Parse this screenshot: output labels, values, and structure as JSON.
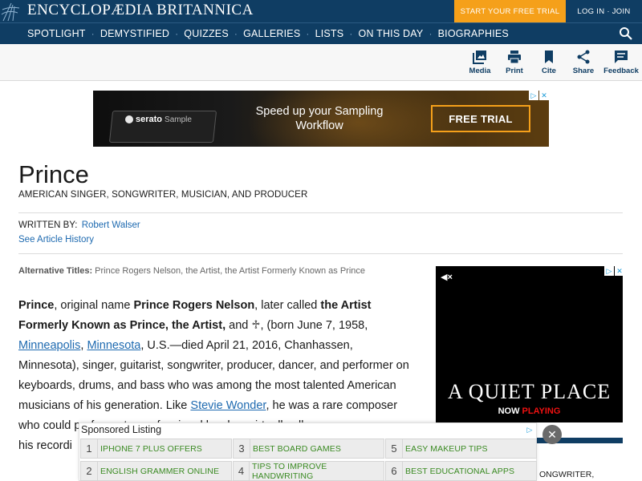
{
  "header": {
    "logo_text": "ENCYCLOPÆDIA BRITANNICA",
    "trial_button": "START YOUR FREE TRIAL",
    "login": "LOG IN · JOIN"
  },
  "nav": {
    "items": [
      "SPOTLIGHT",
      "DEMYSTIFIED",
      "QUIZZES",
      "GALLERIES",
      "LISTS",
      "ON THIS DAY",
      "BIOGRAPHIES"
    ],
    "separator": "·"
  },
  "toolbar": {
    "media": "Media",
    "print": "Print",
    "cite": "Cite",
    "share": "Share",
    "feedback": "Feedback"
  },
  "banner_ad": {
    "brand": "serato",
    "brand_sub": "Sample",
    "headline_line1": "Speed up your Sampling",
    "headline_line2": "Workflow",
    "cta": "FREE TRIAL"
  },
  "article": {
    "title": "Prince",
    "subtitle": "AMERICAN SINGER, SONGWRITER, MUSICIAN, AND PRODUCER",
    "written_by_label": "WRITTEN BY:",
    "author": "Robert Walser",
    "history_link": "See Article History",
    "alt_titles_label": "Alternative Titles:",
    "alt_titles": "Prince Rogers Nelson, the Artist, the Artist Formerly Known as Prince",
    "p1_name": "Prince",
    "p1_t1": ", original name ",
    "p1_full": "Prince Rogers Nelson",
    "p1_t2": ", later called ",
    "p1_artist_formerly": "the Artist Formerly Known as Prince, the Artist,",
    "p1_t3": " and ♱, (born June 7, 1958, ",
    "link_minneapolis": "Minneapolis",
    "p1_comma": ", ",
    "link_minnesota": "Minnesota",
    "p1_t4": ", U.S.—died April 21, 2016, Chanhassen, Minnesota), singer, guitarist, songwriter, producer, dancer, and performer on keyboards, drums, and bass who was among the most talented American musicians of his generation. Like ",
    "link_stevie": "Stevie Wonder",
    "p1_t5": ", he was a rare composer who could perform at a professional level on virtually all",
    "p1_t6": "his recordi"
  },
  "side_ad": {
    "mute": "◀×",
    "title": "A QUIET PLACE",
    "now": "NOW",
    "playing": "PLAYING",
    "peek_text": "ONGWRITER,"
  },
  "sponsored": {
    "title": "Sponsored Listing",
    "items": [
      {
        "num": "1",
        "label": "IPHONE 7 PLUS OFFERS"
      },
      {
        "num": "3",
        "label": "BEST BOARD GAMES"
      },
      {
        "num": "5",
        "label": "EASY MAKEUP TIPS"
      },
      {
        "num": "2",
        "label": "ENGLISH GRAMMER ONLINE"
      },
      {
        "num": "4",
        "label": "TIPS TO IMPROVE HANDWRITING"
      },
      {
        "num": "6",
        "label": "BEST EDUCATIONAL APPS"
      }
    ],
    "close": "✕"
  },
  "colors": {
    "brand_navy": "#0f3d63",
    "accent_orange": "#f5a01a",
    "link_blue": "#1e6ab0",
    "sponsored_green": "#3a8a22"
  }
}
